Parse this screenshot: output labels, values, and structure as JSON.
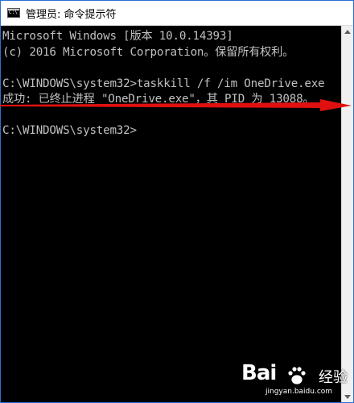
{
  "window": {
    "title": "管理员: 命令提示符",
    "icon": "cmd-icon",
    "colors": {
      "border": "#2b6fd1",
      "console_bg": "#000000",
      "console_text": "#c0c0c0",
      "arrow": "#e01010"
    }
  },
  "console": {
    "lines": [
      "Microsoft Windows [版本 10.0.14393]",
      "(c) 2016 Microsoft Corporation。保留所有权利。",
      "",
      "C:\\WINDOWS\\system32>taskkill /f /im OneDrive.exe",
      "成功: 已终止进程 \"OneDrive.exe\"，其 PID 为 13088。",
      "",
      "C:\\WINDOWS\\system32>"
    ]
  },
  "watermark": {
    "logo": "Bai",
    "jingyan": "经验",
    "url": "jingyan.baidu.com"
  }
}
